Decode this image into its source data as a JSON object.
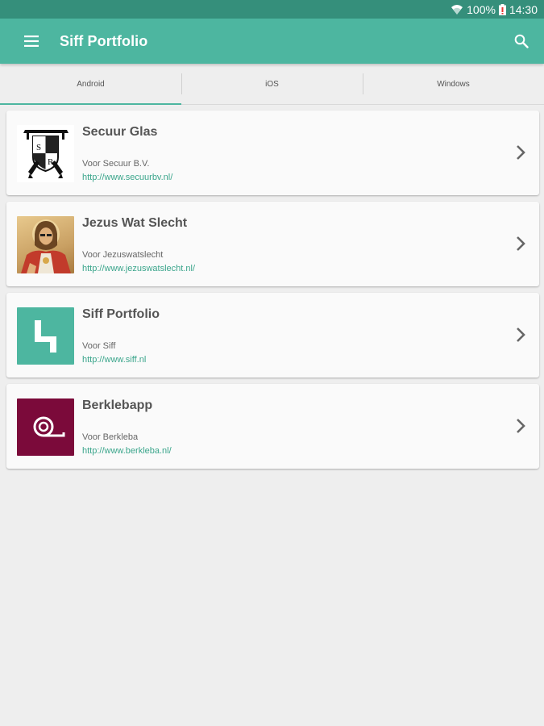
{
  "status_bar": {
    "battery": "100%",
    "time": "14:30"
  },
  "app_bar": {
    "title": "Siff Portfolio",
    "menu_icon": "menu-icon",
    "search_icon": "search-icon"
  },
  "tabs": [
    {
      "label": "Android",
      "active": true
    },
    {
      "label": "iOS",
      "active": false
    },
    {
      "label": "Windows",
      "active": false
    }
  ],
  "items": [
    {
      "title": "Secuur Glas",
      "subtitle": "Voor Secuur B.V.",
      "url": "http://www.secuurbv.nl/",
      "logo_text": "S",
      "logo_text2": "R"
    },
    {
      "title": "Jezus Wat Slecht",
      "subtitle": "Voor Jezuswatslecht",
      "url": "http://www.jezuswatslecht.nl/"
    },
    {
      "title": "Siff Portfolio",
      "subtitle": "Voor Siff",
      "url": "http://www.siff.nl"
    },
    {
      "title": "Berklebapp",
      "subtitle": "Voor Berkleba",
      "url": "http://www.berkleba.nl/"
    }
  ],
  "colors": {
    "primary": "#4db6a0",
    "primary_dark": "#358f7b",
    "link": "#3aa58b",
    "berkleba": "#7b0a3a"
  }
}
